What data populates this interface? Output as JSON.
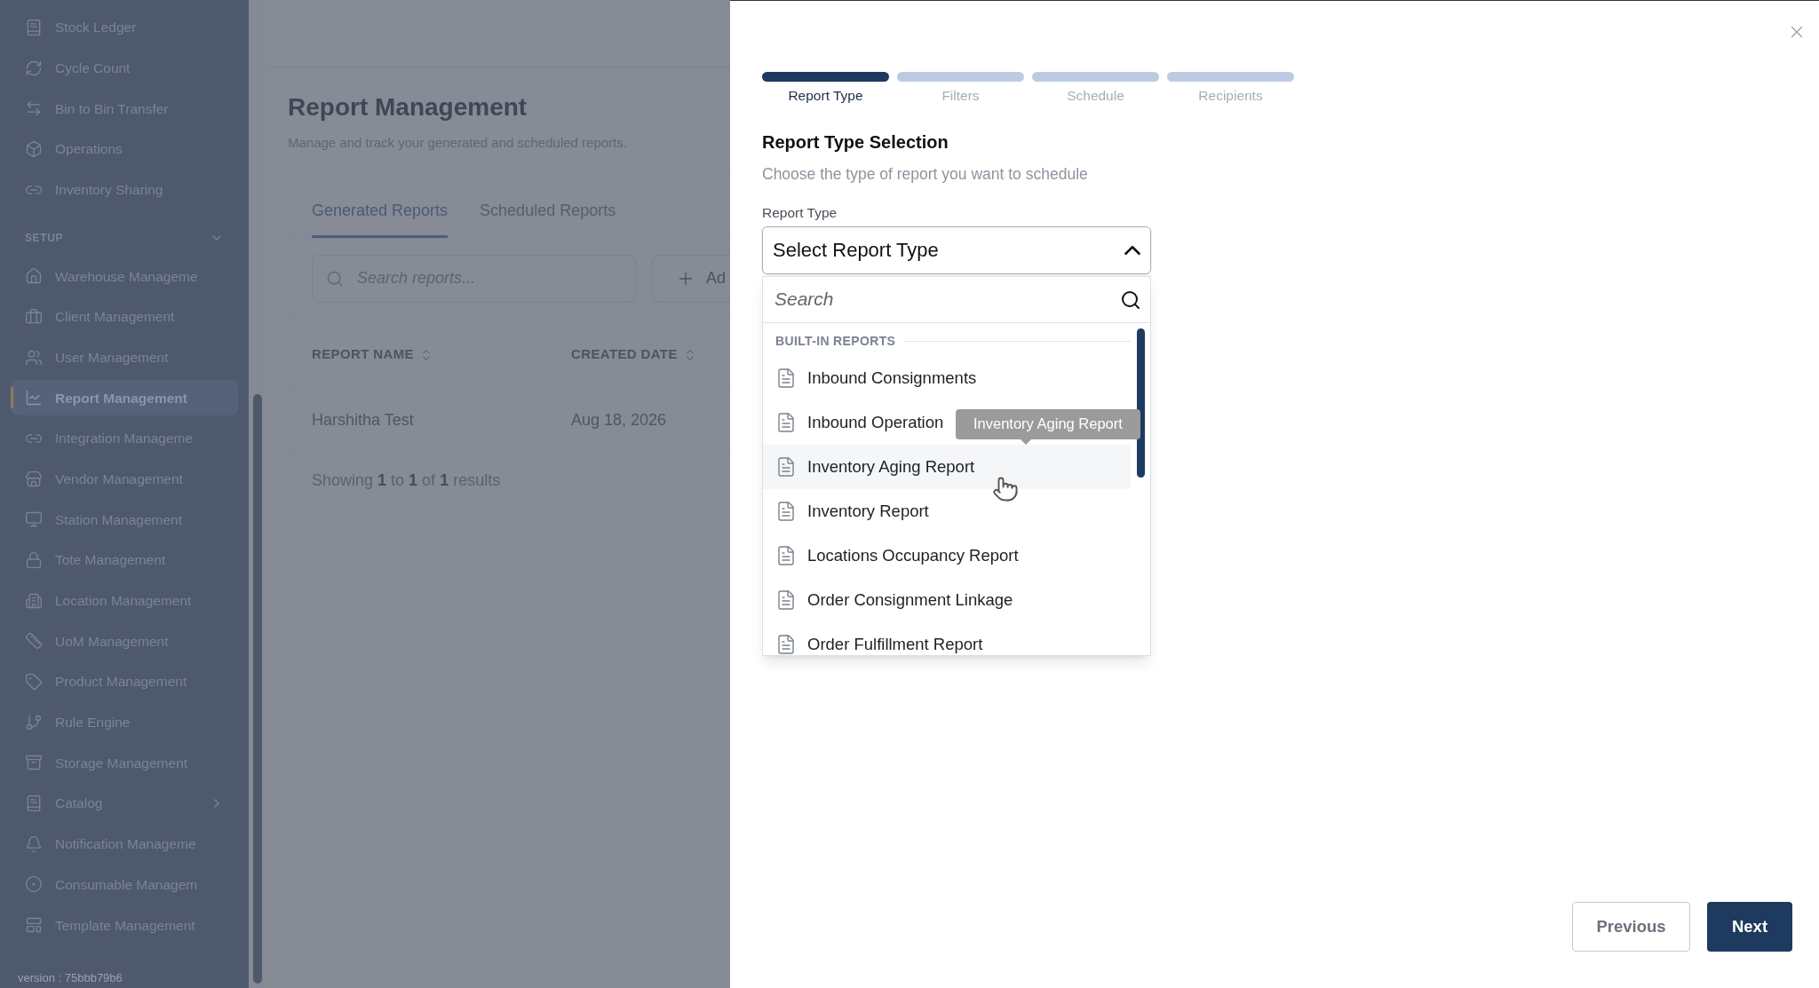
{
  "sidebar": {
    "items": [
      {
        "label": "Stock Ledger",
        "selected": false,
        "expandable": false
      },
      {
        "label": "Cycle Count",
        "selected": false,
        "expandable": false
      },
      {
        "label": "Bin to Bin Transfer",
        "selected": false,
        "expandable": false
      },
      {
        "label": "Operations",
        "selected": false,
        "expandable": false
      },
      {
        "label": "Inventory Sharing",
        "selected": false,
        "expandable": false
      }
    ],
    "sections": [
      {
        "title": "SETUP",
        "expanded": true,
        "items": [
          {
            "label": "Warehouse Manageme",
            "selected": false,
            "expandable": false
          },
          {
            "label": "Client Management",
            "selected": false,
            "expandable": false
          },
          {
            "label": "User Management",
            "selected": false,
            "expandable": false
          },
          {
            "label": "Report Management",
            "selected": true,
            "expandable": false
          },
          {
            "label": "Integration Manageme",
            "selected": false,
            "expandable": false
          },
          {
            "label": "Vendor Management",
            "selected": false,
            "expandable": false
          },
          {
            "label": "Station Management",
            "selected": false,
            "expandable": false
          },
          {
            "label": "Tote Management",
            "selected": false,
            "expandable": false
          },
          {
            "label": "Location Management",
            "selected": false,
            "expandable": false
          },
          {
            "label": "UoM Management",
            "selected": false,
            "expandable": false
          },
          {
            "label": "Product Management",
            "selected": false,
            "expandable": false
          },
          {
            "label": "Rule Engine",
            "selected": false,
            "expandable": false
          },
          {
            "label": "Storage Management",
            "selected": false,
            "expandable": false
          },
          {
            "label": "Catalog",
            "selected": false,
            "expandable": true
          },
          {
            "label": "Notification Manageme",
            "selected": false,
            "expandable": false
          },
          {
            "label": "Consumable Managem",
            "selected": false,
            "expandable": false
          },
          {
            "label": "Template Management",
            "selected": false,
            "expandable": false
          }
        ]
      }
    ],
    "version": "version : 75bbb79b6"
  },
  "page": {
    "title": "Report Management",
    "subtitle": "Manage and track your generated and scheduled reports.",
    "tabs": [
      {
        "label": "Generated Reports",
        "selected": true
      },
      {
        "label": "Scheduled Reports",
        "selected": false
      }
    ],
    "search": {
      "placeholder": "Search reports..."
    },
    "add_button": "Ad",
    "table": {
      "columns": [
        "REPORT NAME",
        "CREATED DATE"
      ],
      "rows": [
        [
          "Harshitha Test",
          "Aug 18, 2026"
        ]
      ]
    },
    "footer": "Showing **1** to **1** of **1** results"
  },
  "drawer": {
    "steps": [
      {
        "label": "Report Type",
        "selected": true
      },
      {
        "label": "Filters",
        "selected": false
      },
      {
        "label": "Schedule",
        "selected": false
      },
      {
        "label": "Recipients",
        "selected": false
      }
    ],
    "heading": "Report Type Selection",
    "description": "Choose the type of report you want to schedule",
    "field_label": "Report Type",
    "select": {
      "placeholder": "Select Report Type",
      "expanded": true,
      "search": {
        "placeholder": "Search"
      },
      "group": "BUILT-IN REPORTS",
      "options": [
        {
          "label": "Inbound Consignments",
          "highlighted": false
        },
        {
          "label": "Inbound Operation",
          "highlighted": false
        },
        {
          "label": "Inventory Aging Report",
          "highlighted": true
        },
        {
          "label": "Inventory Report",
          "highlighted": false
        },
        {
          "label": "Locations Occupancy Report",
          "highlighted": false
        },
        {
          "label": "Order Consignment Linkage",
          "highlighted": false
        },
        {
          "label": "Order Fulfillment Report",
          "highlighted": false
        }
      ]
    },
    "tooltip": "Inventory Aging Report",
    "buttons": {
      "previous": "Previous",
      "next": "Next"
    }
  }
}
